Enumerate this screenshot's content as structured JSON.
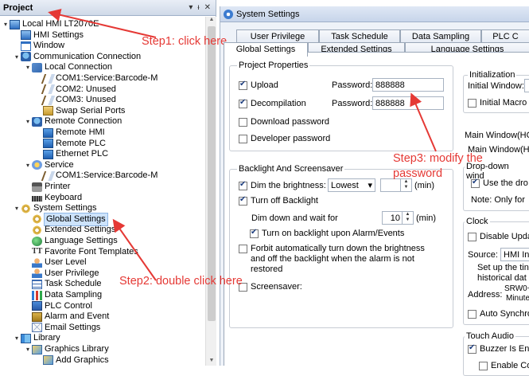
{
  "project_panel": {
    "title": "Project",
    "header_buttons": [
      "▾",
      "ᵻ",
      "✕"
    ],
    "tree": [
      {
        "label": "Local HMI LT2070E",
        "icon": "screen-icon",
        "arrow": "▾"
      },
      {
        "label": "HMI Settings",
        "icon": "screen-icon",
        "arrow": ""
      },
      {
        "label": "Window",
        "icon": "window-icon",
        "arrow": ""
      },
      {
        "label": "Communication Connection",
        "icon": "network-icon",
        "arrow": "▾"
      },
      {
        "label": "Local Connection",
        "icon": "plug-icon",
        "arrow": "▾"
      },
      {
        "label": "COM1:Service:Barcode-M",
        "icon": "com-port-icon",
        "arrow": ""
      },
      {
        "label": "COM2: Unused",
        "icon": "com-port-icon",
        "arrow": ""
      },
      {
        "label": "COM3: Unused",
        "icon": "com-port-icon",
        "arrow": ""
      },
      {
        "label": "Swap Serial Ports",
        "icon": "swap-icon",
        "arrow": ""
      },
      {
        "label": "Remote Connection",
        "icon": "network-icon",
        "arrow": "▾"
      },
      {
        "label": "Remote HMI",
        "icon": "remote-icon",
        "arrow": ""
      },
      {
        "label": "Remote PLC",
        "icon": "remote-icon",
        "arrow": ""
      },
      {
        "label": "Ethernet PLC",
        "icon": "remote-icon",
        "arrow": ""
      },
      {
        "label": "Service",
        "icon": "service-icon",
        "arrow": "▾"
      },
      {
        "label": "COM1:Service:Barcode-M",
        "icon": "com-port-icon",
        "arrow": ""
      },
      {
        "label": "Printer",
        "icon": "printer-icon",
        "arrow": ""
      },
      {
        "label": "Keyboard",
        "icon": "keyboard-icon",
        "arrow": ""
      },
      {
        "label": "System Settings",
        "icon": "gear-icon",
        "arrow": "▾"
      },
      {
        "label": "Global Settings",
        "icon": "gear-icon",
        "arrow": "",
        "selected": true
      },
      {
        "label": "Extended Settings",
        "icon": "gear-icon",
        "arrow": ""
      },
      {
        "label": "Language Settings",
        "icon": "globe-icon",
        "arrow": ""
      },
      {
        "label": "Favorite Font Templates",
        "icon": "font-icon",
        "arrow": ""
      },
      {
        "label": "User Level",
        "icon": "user-icon",
        "arrow": ""
      },
      {
        "label": "User Privilege",
        "icon": "user-icon",
        "arrow": ""
      },
      {
        "label": "Task Schedule",
        "icon": "table-icon",
        "arrow": ""
      },
      {
        "label": "Data Sampling",
        "icon": "bar-chart-icon",
        "arrow": ""
      },
      {
        "label": "PLC Control",
        "icon": "plc-icon",
        "arrow": ""
      },
      {
        "label": "Alarm and Event",
        "icon": "alarm-icon",
        "arrow": ""
      },
      {
        "label": "Email Settings",
        "icon": "email-icon",
        "arrow": ""
      },
      {
        "label": "Library",
        "icon": "library-icon",
        "arrow": "▾"
      },
      {
        "label": "Graphics Library",
        "icon": "graphics-icon",
        "arrow": "▾"
      },
      {
        "label": "Add Graphics",
        "icon": "graphics-icon",
        "arrow": ""
      }
    ]
  },
  "settings_panel": {
    "title": "System Settings",
    "tabs_row1": [
      "User Privilege",
      "Task Schedule",
      "Data Sampling",
      "PLC C"
    ],
    "tabs_row2": [
      "Global Settings",
      "Extended Settings",
      "Language Settings"
    ],
    "active_tab": "Global Settings",
    "project_properties": {
      "title": "Project Properties",
      "upload_label": "Upload",
      "upload_checked": true,
      "upload_password_label": "Password:",
      "upload_password": "888888",
      "decompilation_label": "Decompilation",
      "decompilation_checked": true,
      "decompilation_password_label": "Password:",
      "decompilation_password": "888888",
      "download_password_label": "Download password",
      "developer_password_label": "Developer password"
    },
    "backlight": {
      "title": "Backlight And Screensaver",
      "dim_label": "Dim the brightness:",
      "dim_value": "Lowest",
      "dim_unit": "(min)",
      "turn_off_label": "Turn off Backlight",
      "dim_down_label": "Dim down and wait for",
      "dim_down_value": "10",
      "dim_down_unit": "(min)",
      "alarm_label": "Turn on backlight upon Alarm/Events",
      "forbit_label": "Forbit automatically turn down the brightness and off the backlight when the alarm is not restored",
      "screensaver_label": "Screensaver:"
    },
    "right_column": {
      "initialization_title": "Initialization",
      "initial_window_label": "Initial Window:",
      "initial_macro_label": "Initial Macro",
      "main_window_title": "Main Window(HC",
      "main_window_sub": "Main Window(H",
      "dropdown_title": "Drop-down wind",
      "use_the_dro_label": "Use the dro",
      "note_label": "Note: Only for",
      "clock_title": "Clock",
      "disable_upda_label": "Disable Upda",
      "source_label": "Source:",
      "source_value": "HMI In",
      "setup_label": "Set up the tin",
      "historical_label": "historical dat",
      "address_label": "Address:",
      "address_value_1": "SRW0~",
      "address_value_2": "Minute",
      "auto_sync_label": "Auto Synchror",
      "touch_audio_title": "Touch Audio",
      "buzzer_label": "Buzzer Is Ena",
      "enable_co_label": "Enable Co"
    }
  },
  "annotations": {
    "step1": "Step1: click here",
    "step2": "Step2: double click here",
    "step3_line1": "Step3: modify the",
    "step3_line2": "password",
    "color": "#e53935"
  }
}
